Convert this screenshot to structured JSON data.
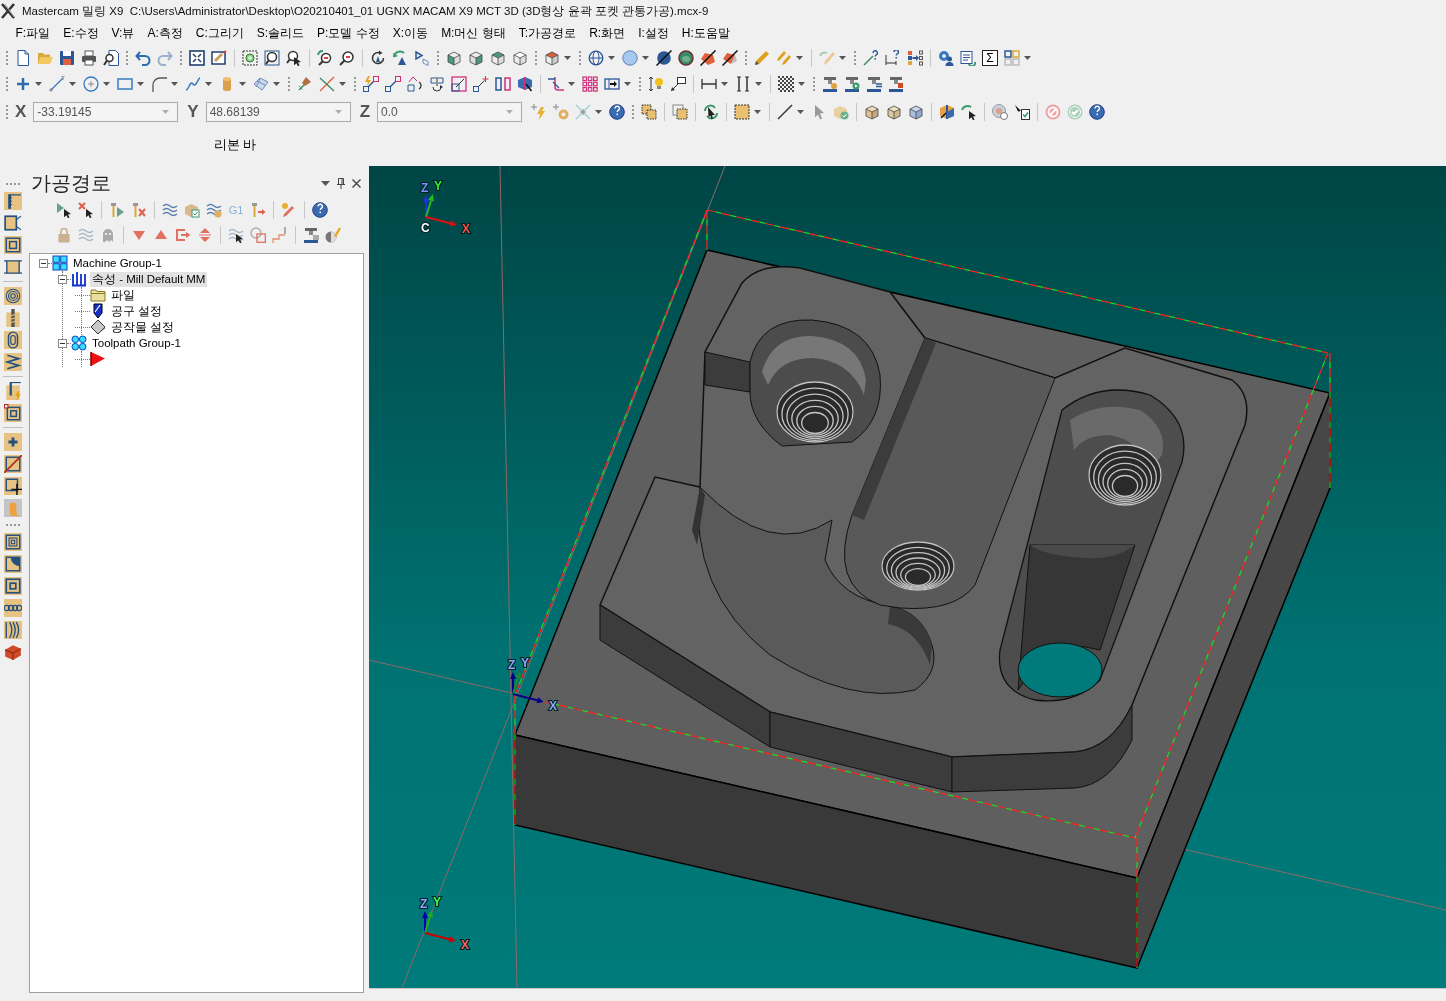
{
  "window": {
    "title": "Mastercam 밀링 X9  C:\\Users\\Administrator\\Desktop\\O20210401_01 UGNX MACAM X9 MCT 3D (3D형상 윤곽 포켓 관통가공).mcx-9"
  },
  "menu": [
    "F:파일",
    "E:수정",
    "V:뷰",
    "A:측정",
    "C:그리기",
    "S:솔리드",
    "P:모델 수정",
    "X:이동",
    "M:머신 형태",
    "T:가공경로",
    "R:화면",
    "I:설정",
    "H:도움말"
  ],
  "toolbar": {
    "summation_glyph": "Σ"
  },
  "coordinates": [
    {
      "axis": "X",
      "value": "-33.19145"
    },
    {
      "axis": "Y",
      "value": "48.68139"
    },
    {
      "axis": "Z",
      "value": "0.0"
    }
  ],
  "ribbon_bar": {
    "label": "리본 바"
  },
  "toolpath_panel": {
    "title": "가공경로",
    "toolbar_label": "G1",
    "tree": [
      {
        "kind": "machine-group",
        "label": "Machine Group-1",
        "expanded": true,
        "selected": false,
        "children": [
          {
            "kind": "properties",
            "label": "속성 - Mill Default MM",
            "expanded": true,
            "selected": true,
            "children": [
              {
                "kind": "files",
                "label": "파일",
                "selected": false
              },
              {
                "kind": "tool-settings",
                "label": "공구 설정",
                "selected": false
              },
              {
                "kind": "stock-setup",
                "label": "공작물 설정",
                "selected": false
              }
            ]
          },
          {
            "kind": "toolpath-group",
            "label": "Toolpath Group-1",
            "expanded": true,
            "selected": false,
            "children": [
              {
                "kind": "insert-marker",
                "selected": false
              }
            ]
          }
        ]
      }
    ]
  },
  "viewport": {
    "triads": [
      {
        "kind": "view",
        "x": "X",
        "y": "Y",
        "z": "Z",
        "plane": "C"
      },
      {
        "kind": "origin",
        "x": "X",
        "y": "Y",
        "z": "Z"
      },
      {
        "kind": "world",
        "x": "X",
        "y": "Y",
        "z": "Z"
      }
    ]
  }
}
